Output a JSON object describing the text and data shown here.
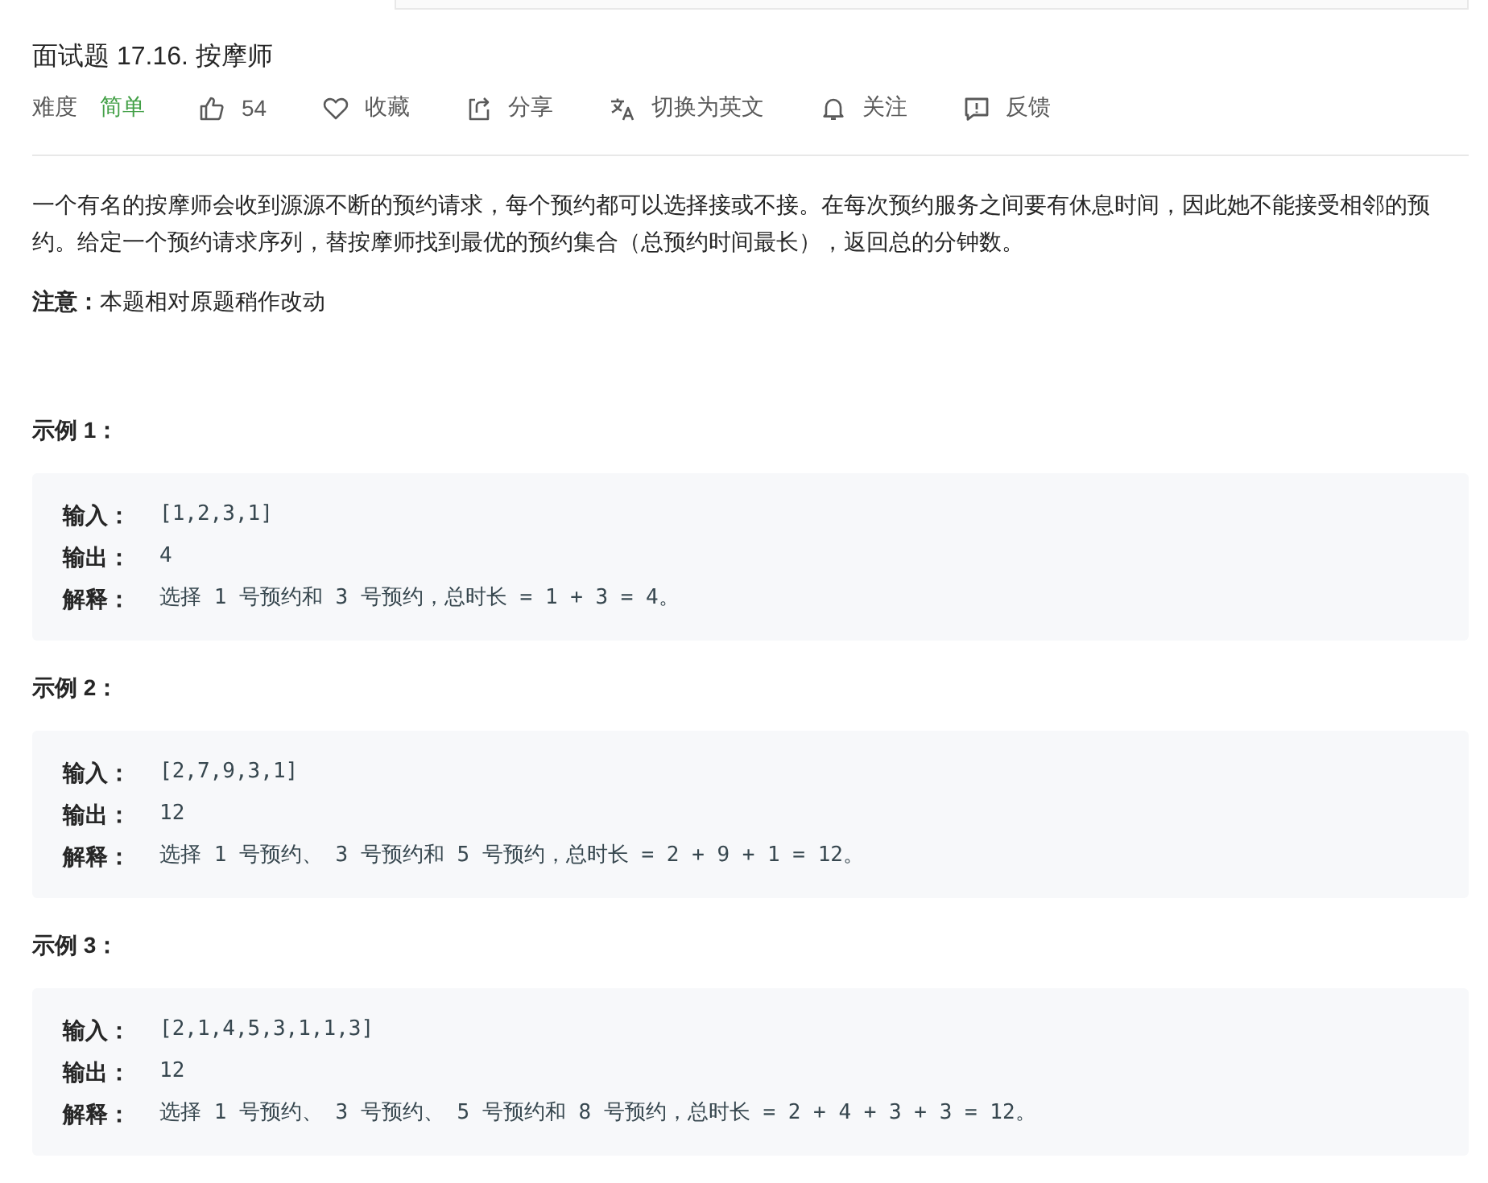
{
  "title": "面试题 17.16. 按摩师",
  "meta": {
    "difficulty_label": "难度",
    "difficulty": {
      "value": "简单",
      "kind": "easy"
    },
    "actions": [
      {
        "kind": "like",
        "label": "54"
      },
      {
        "kind": "favorite",
        "label": "收藏"
      },
      {
        "kind": "share",
        "label": "分享"
      },
      {
        "kind": "translate",
        "label": "切换为英文"
      },
      {
        "kind": "follow",
        "label": "关注"
      },
      {
        "kind": "feedback",
        "label": "反馈"
      }
    ]
  },
  "description": "一个有名的按摩师会收到源源不断的预约请求，每个预约都可以选择接或不接。在每次预约服务之间要有休息时间，因此她不能接受相邻的预约。给定一个预约请求序列，替按摩师找到最优的预约集合（总预约时间最长），返回总的分钟数。",
  "note": {
    "label": "注意：",
    "text": "本题相对原题稍作改动"
  },
  "examples": [
    {
      "heading": "示例 1：",
      "lines": [
        {
          "label": "输入：",
          "value": "[1,2,3,1]"
        },
        {
          "label": "输出：",
          "value": "4"
        },
        {
          "label": "解释：",
          "value": "选择 1 号预约和 3 号预约，总时长 = 1 + 3 = 4。"
        }
      ]
    },
    {
      "heading": "示例 2：",
      "lines": [
        {
          "label": "输入：",
          "value": "[2,7,9,3,1]"
        },
        {
          "label": "输出：",
          "value": "12"
        },
        {
          "label": "解释：",
          "value": "选择 1 号预约、 3 号预约和 5 号预约，总时长 = 2 + 9 + 1 = 12。"
        }
      ]
    },
    {
      "heading": "示例 3：",
      "lines": [
        {
          "label": "输入：",
          "value": "[2,1,4,5,3,1,1,3]"
        },
        {
          "label": "输出：",
          "value": "12"
        },
        {
          "label": "解释：",
          "value": "选择 1 号预约、 3 号预约、 5 号预约和 8 号预约，总时长 = 2 + 4 + 3 + 3 = 12。"
        }
      ]
    }
  ]
}
